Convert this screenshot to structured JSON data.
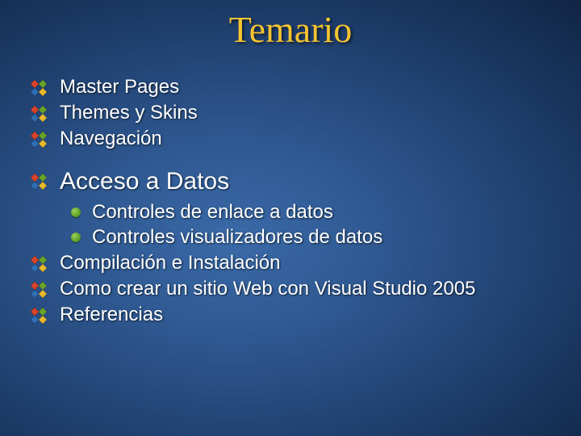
{
  "title": "Temario",
  "items": {
    "l1a": "Master Pages",
    "l1b": "Themes y Skins",
    "l1c": "Navegación",
    "l1d": "Acceso a Datos",
    "l2a": "Controles de enlace a datos",
    "l2b": "Controles visualizadores de datos",
    "l1e": "Compilación e Instalación",
    "l1f": "Como crear un sitio Web con Visual Studio 2005",
    "l1g": "Referencias"
  }
}
